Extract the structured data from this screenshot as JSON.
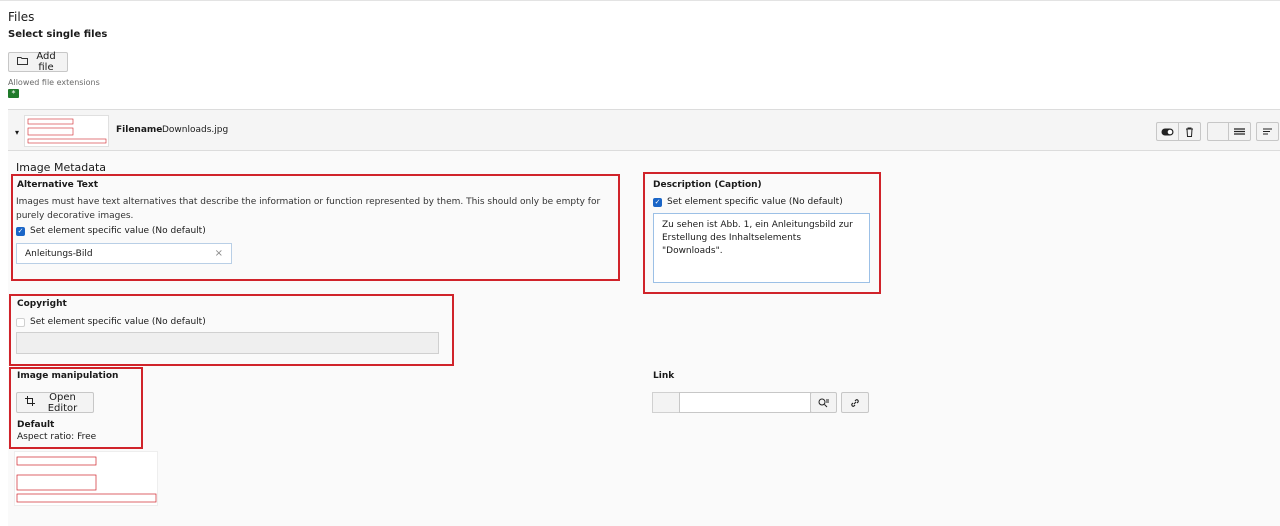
{
  "files": {
    "title": "Files",
    "select_label": "Select single files",
    "add_file_label": "Add file",
    "allowed_label": "Allowed file extensions",
    "allowed_badge": "*"
  },
  "item": {
    "filename_label": "Filename",
    "filename_value": "Downloads.jpg"
  },
  "metadata": {
    "title": "Image Metadata",
    "alt": {
      "label": "Alternative Text",
      "help": "Images must have text alternatives that describe the information or function represented by them. This should only be empty for purely decorative images.",
      "checkbox_label": "Set element specific value (No default)",
      "value": "Anleitungs-Bild"
    },
    "description": {
      "label": "Description (Caption)",
      "checkbox_label": "Set element specific value (No default)",
      "value": "Zu sehen ist Abb. 1, ein Anleitungsbild zur Erstellung des Inhaltselements \"Downloads\"."
    },
    "copyright": {
      "label": "Copyright",
      "checkbox_label": "Set element specific value (No default)"
    },
    "manipulation": {
      "label": "Image manipulation",
      "button_label": "Open Editor",
      "default_label": "Default",
      "aspect_label": "Aspect ratio: Free"
    },
    "link": {
      "label": "Link"
    }
  },
  "icons": {
    "folder": "folder-icon",
    "caret": "caret-down-icon",
    "toggle": "toggle-icon",
    "trash": "trash-icon",
    "menu": "menu-icon",
    "sort": "sort-icon",
    "clear": "clear-icon",
    "crop": "crop-icon",
    "link_browse": "link-browse-icon",
    "link": "link-icon"
  },
  "colors": {
    "highlight": "#d0232a",
    "checkbox": "#1a65c7",
    "badge": "#1f7a2a"
  }
}
